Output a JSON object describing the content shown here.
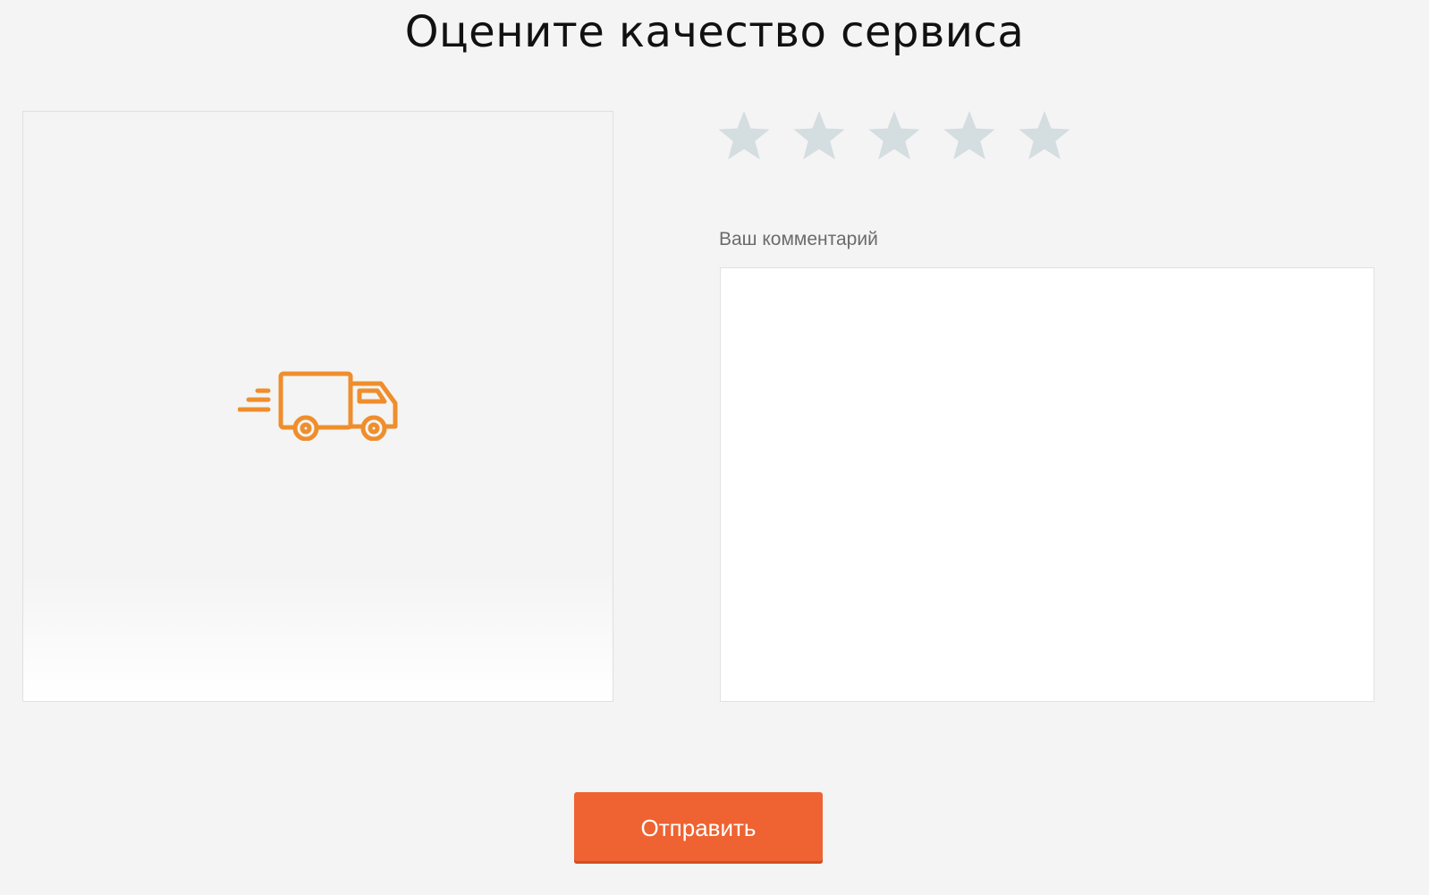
{
  "header": {
    "title": "Оцените качество сервиса"
  },
  "image_panel": {
    "icon": "delivery-truck-icon",
    "icon_color": "#ee8e2c"
  },
  "rating": {
    "max": 5,
    "selected": 0,
    "star_color_empty": "#d4dde0"
  },
  "comment": {
    "label": "Ваш комментарий",
    "value": ""
  },
  "submit": {
    "label": "Отправить",
    "color": "#ee6331"
  }
}
